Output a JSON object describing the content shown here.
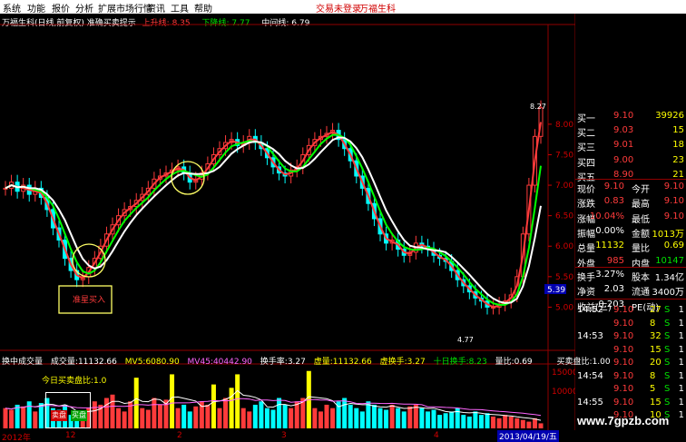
{
  "menu": {
    "items": [
      "系统",
      "功能",
      "报价",
      "分析",
      "扩展市场行情",
      "资讯",
      "工具",
      "帮助"
    ],
    "login_status": "交易未登录",
    "stock_name": "万福生科"
  },
  "chart_header": {
    "title": "万福生科(日线,前复权)",
    "indicator_name": "准确买卖提示",
    "up_label": "上升线:",
    "up_value": "8.35",
    "down_label": "下降线:",
    "down_value": "7.77",
    "mid_label": "中间线:",
    "mid_value": "6.79"
  },
  "price_axis": {
    "ticks": [
      "8.00",
      "7.50",
      "7.00",
      "6.50",
      "6.00",
      "5.50",
      "5.00"
    ],
    "current_price_tag": "5.39",
    "top_marker": "8.27",
    "low_marker": "4.77"
  },
  "annotation": {
    "buy_label": "准星买入"
  },
  "order_book": {
    "asks": [
      {
        "label": "买一",
        "price": "9.10",
        "volume": "39926"
      },
      {
        "label": "买二",
        "price": "9.03",
        "volume": "15"
      },
      {
        "label": "买三",
        "price": "9.01",
        "volume": "18"
      },
      {
        "label": "买四",
        "price": "9.00",
        "volume": "23"
      },
      {
        "label": "买五",
        "price": "8.90",
        "volume": "21"
      }
    ]
  },
  "quote": {
    "rows": [
      {
        "l1": "现价",
        "v1": "9.10",
        "l2": "今开",
        "v2": "9.10"
      },
      {
        "l1": "涨跌",
        "v1": "0.83",
        "l2": "最高",
        "v2": "9.10"
      },
      {
        "l1": "涨幅",
        "v1": "10.04%",
        "l2": "最低",
        "v2": "9.10"
      },
      {
        "l1": "振幅",
        "v1": "0.00%",
        "l2": "金额",
        "v2": "1013万"
      },
      {
        "l1": "总量",
        "v1": "11132",
        "l2": "量比",
        "v2": "0.69"
      },
      {
        "l1": "外盘",
        "v1": "985",
        "l2": "内盘",
        "v2": "10147"
      },
      {
        "l1": "换手",
        "v1": "3.27%",
        "l2": "股本",
        "v2": "1.34亿"
      },
      {
        "l1": "净资",
        "v1": "2.03",
        "l2": "流通",
        "v2": "3400万"
      },
      {
        "l1": "收益(三)",
        "v1": "-0.203",
        "l2": "PE(动)",
        "v2": ""
      }
    ]
  },
  "ticks": [
    {
      "time": "14:52",
      "price": "9.10",
      "vol": "27",
      "side": "S",
      "n": "1"
    },
    {
      "time": "",
      "price": "9.10",
      "vol": "8",
      "side": "S",
      "n": "1"
    },
    {
      "time": "14:53",
      "price": "9.10",
      "vol": "32",
      "side": "S",
      "n": "1"
    },
    {
      "time": "",
      "price": "9.10",
      "vol": "15",
      "side": "S",
      "n": "1"
    },
    {
      "time": "",
      "price": "9.10",
      "vol": "20",
      "side": "S",
      "n": "1"
    },
    {
      "time": "14:54",
      "price": "9.10",
      "vol": "8",
      "side": "S",
      "n": "1"
    },
    {
      "time": "",
      "price": "9.10",
      "vol": "5",
      "side": "S",
      "n": "1"
    },
    {
      "time": "14:55",
      "price": "9.10",
      "vol": "15",
      "side": "S",
      "n": "1"
    },
    {
      "time": "",
      "price": "9.10",
      "vol": "10",
      "side": "S",
      "n": "1"
    }
  ],
  "volume_header": {
    "indicator": "换中成交量",
    "vol_label": "成交量:",
    "vol_value": "11132.66",
    "mv5_label": "MV5:",
    "mv5_value": "6080.90",
    "mv45_label": "MV45:",
    "mv45_value": "40442.90",
    "turnover_label": "换手率:",
    "turnover_value": "3.27",
    "vol2_label": "虚量:",
    "vol2_value": "11132.66",
    "vturn_label": "虚换手:",
    "vturn_value": "3.27",
    "ten_label": "十日换手:",
    "ten_value": "8.23",
    "ratio_label": "量比:",
    "ratio_value": "0.69",
    "buysell_label": "买卖盘比:",
    "buysell_value": "1.00"
  },
  "today_ratio": {
    "label": "今日买卖盘比:",
    "value": "1.0",
    "btn_sell": "卖盘",
    "btn_buy": "买盘"
  },
  "volume_axis": {
    "ticks": [
      "15000",
      "10000"
    ]
  },
  "date_axis": {
    "labels": [
      "2012年",
      "12",
      "2",
      "3",
      "4"
    ],
    "current_date": "2013/04/19/五"
  },
  "watermark": "www.7gpzb.com",
  "chart_data": {
    "type": "candlestick",
    "title": "万福生科(日线,前复权)",
    "ylim": [
      4.5,
      8.4
    ],
    "close": [
      6.95,
      7.05,
      6.9,
      7.0,
      6.85,
      6.95,
      6.8,
      6.6,
      6.3,
      6.1,
      5.8,
      5.6,
      5.45,
      5.5,
      5.65,
      5.8,
      6.0,
      6.2,
      6.35,
      6.5,
      6.6,
      6.65,
      6.75,
      6.85,
      6.95,
      7.1,
      7.15,
      7.2,
      7.25,
      7.3,
      7.2,
      7.05,
      7.1,
      7.2,
      7.35,
      7.5,
      7.6,
      7.7,
      7.75,
      7.65,
      7.7,
      7.8,
      7.7,
      7.6,
      7.45,
      7.3,
      7.2,
      7.15,
      7.25,
      7.3,
      7.5,
      7.65,
      7.75,
      7.8,
      7.85,
      7.9,
      7.75,
      7.6,
      7.4,
      7.15,
      6.95,
      6.7,
      6.45,
      6.2,
      6.05,
      6.1,
      5.95,
      5.85,
      5.9,
      6.05,
      6.0,
      5.95,
      5.85,
      5.8,
      5.75,
      5.6,
      5.45,
      5.35,
      5.25,
      5.15,
      5.1,
      5.0,
      5.0,
      5.05,
      5.1,
      5.2,
      5.5,
      6.2,
      7.0,
      7.8,
      8.27
    ],
    "volume": [
      6000,
      5500,
      7000,
      6500,
      8000,
      5000,
      7500,
      9000,
      6000,
      5500,
      7000,
      4000,
      3000,
      5000,
      6000,
      8000,
      7000,
      9000,
      10000,
      6000,
      5000,
      8000,
      15000,
      6000,
      5500,
      9000,
      7000,
      8500,
      16000,
      6000,
      7000,
      5000,
      6500,
      8000,
      7000,
      13000,
      6000,
      9000,
      12000,
      16000,
      6000,
      5000,
      7000,
      8000,
      6000,
      5500,
      9000,
      7000,
      6000,
      8000,
      9000,
      17000,
      6000,
      5000,
      7000,
      6000,
      8000,
      9000,
      7000,
      6000,
      5000,
      8000,
      7000,
      6000,
      5500,
      7000,
      6000,
      5000,
      6500,
      7000,
      6000,
      5000,
      5500,
      4000,
      4500,
      5000,
      6000,
      4000,
      3500,
      5000,
      4000,
      4500,
      3500,
      3000,
      4000,
      3500,
      3000,
      2500,
      2000,
      3000,
      1500
    ]
  }
}
